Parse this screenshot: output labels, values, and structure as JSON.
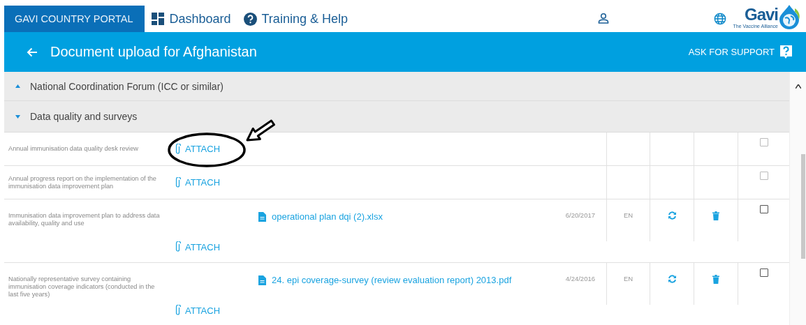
{
  "topbar": {
    "portal": "GAVI COUNTRY PORTAL",
    "nav": [
      {
        "kind": "dashboard",
        "label": "Dashboard"
      },
      {
        "kind": "help",
        "label": "Training & Help"
      }
    ],
    "logo": {
      "name": "Gavi",
      "tagline": "The Vaccine Alliance"
    }
  },
  "header": {
    "title": "Document upload for Afghanistan",
    "support": "ASK FOR SUPPORT"
  },
  "sections": [
    {
      "title": "National Coordination Forum (ICC or similar)",
      "expanded": false
    },
    {
      "title": "Data quality and surveys",
      "expanded": true
    }
  ],
  "documents": [
    {
      "label": "Annual immunisation data quality desk review",
      "attach": "ATTACH",
      "checked": false,
      "disabled": true
    },
    {
      "label": "Annual progress report on the implementation of the immunisation data improvement plan",
      "attach": "ATTACH",
      "checked": false,
      "disabled": true
    },
    {
      "label": "Immunisation data improvement plan to address data availability, quality and use",
      "attach": "ATTACH",
      "file": {
        "name": "operational plan dqi (2).xlsx",
        "date": "6/20/2017",
        "language": "EN"
      },
      "checked": false,
      "disabled": false
    },
    {
      "label": "Nationally representative survey containing immunisation coverage indicators (conducted in the last five years)",
      "attach": "ATTACH",
      "file": {
        "name": "24. epi coverage-survey (review evaluation report) 2013.pdf",
        "date": "4/24/2016",
        "language": "EN"
      },
      "checked": false,
      "disabled": false
    }
  ]
}
